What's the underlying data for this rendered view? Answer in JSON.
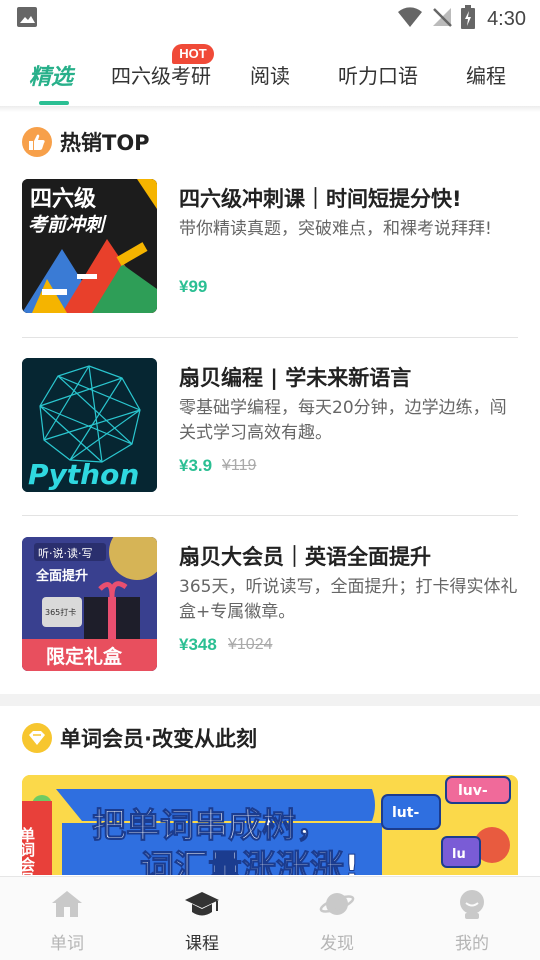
{
  "status_bar": {
    "time": "4:30"
  },
  "top_tabs": {
    "tabs": [
      {
        "label": "精选",
        "active": true
      },
      {
        "label": "四六级考研",
        "badge": "HOT"
      },
      {
        "label": "阅读"
      },
      {
        "label": "听力口语"
      },
      {
        "label": "编程"
      }
    ]
  },
  "hot_section": {
    "title": "热销TOP",
    "products": [
      {
        "title": "四六级冲刺课｜时间短提分快!",
        "desc": "带你精读真题，突破难点，和裸考说拜拜!",
        "price": "¥99",
        "original_price": "",
        "thumb_text": [
          "四六级",
          "考前冲刺"
        ]
      },
      {
        "title": "扇贝编程 | 学未来新语言",
        "desc": "零基础学编程，每天20分钟，边学边练，闯关式学习高效有趣。",
        "price": "¥3.9",
        "original_price": "¥119",
        "thumb_text": [
          "Python"
        ]
      },
      {
        "title": "扇贝大会员｜英语全面提升",
        "desc": "365天，听说读写，全面提升；打卡得实体礼盒+专属徽章。",
        "price": "¥348",
        "original_price": "¥1024",
        "thumb_text": [
          "听·说·读·写",
          "全面提升",
          "限定礼盒",
          "365打卡"
        ]
      }
    ]
  },
  "vocab_section": {
    "title": "单词会员·改变从此刻",
    "banner": {
      "headline_1": "把单词串成树，",
      "headline_2": "词汇量涨涨涨!",
      "side_tag": "单词会员",
      "chip_1": "lut-",
      "chip_2": "luv-",
      "chip_3": "lu"
    }
  },
  "bottom_nav": {
    "items": [
      {
        "label": "单词",
        "icon": "home-icon"
      },
      {
        "label": "课程",
        "icon": "graduation-cap-icon",
        "active": true
      },
      {
        "label": "发现",
        "icon": "planet-icon"
      },
      {
        "label": "我的",
        "icon": "profile-icon"
      }
    ]
  },
  "colors": {
    "accent_green": "#2bbf93",
    "hot_red": "#f04a38",
    "banner_yellow": "#fbd94a"
  }
}
